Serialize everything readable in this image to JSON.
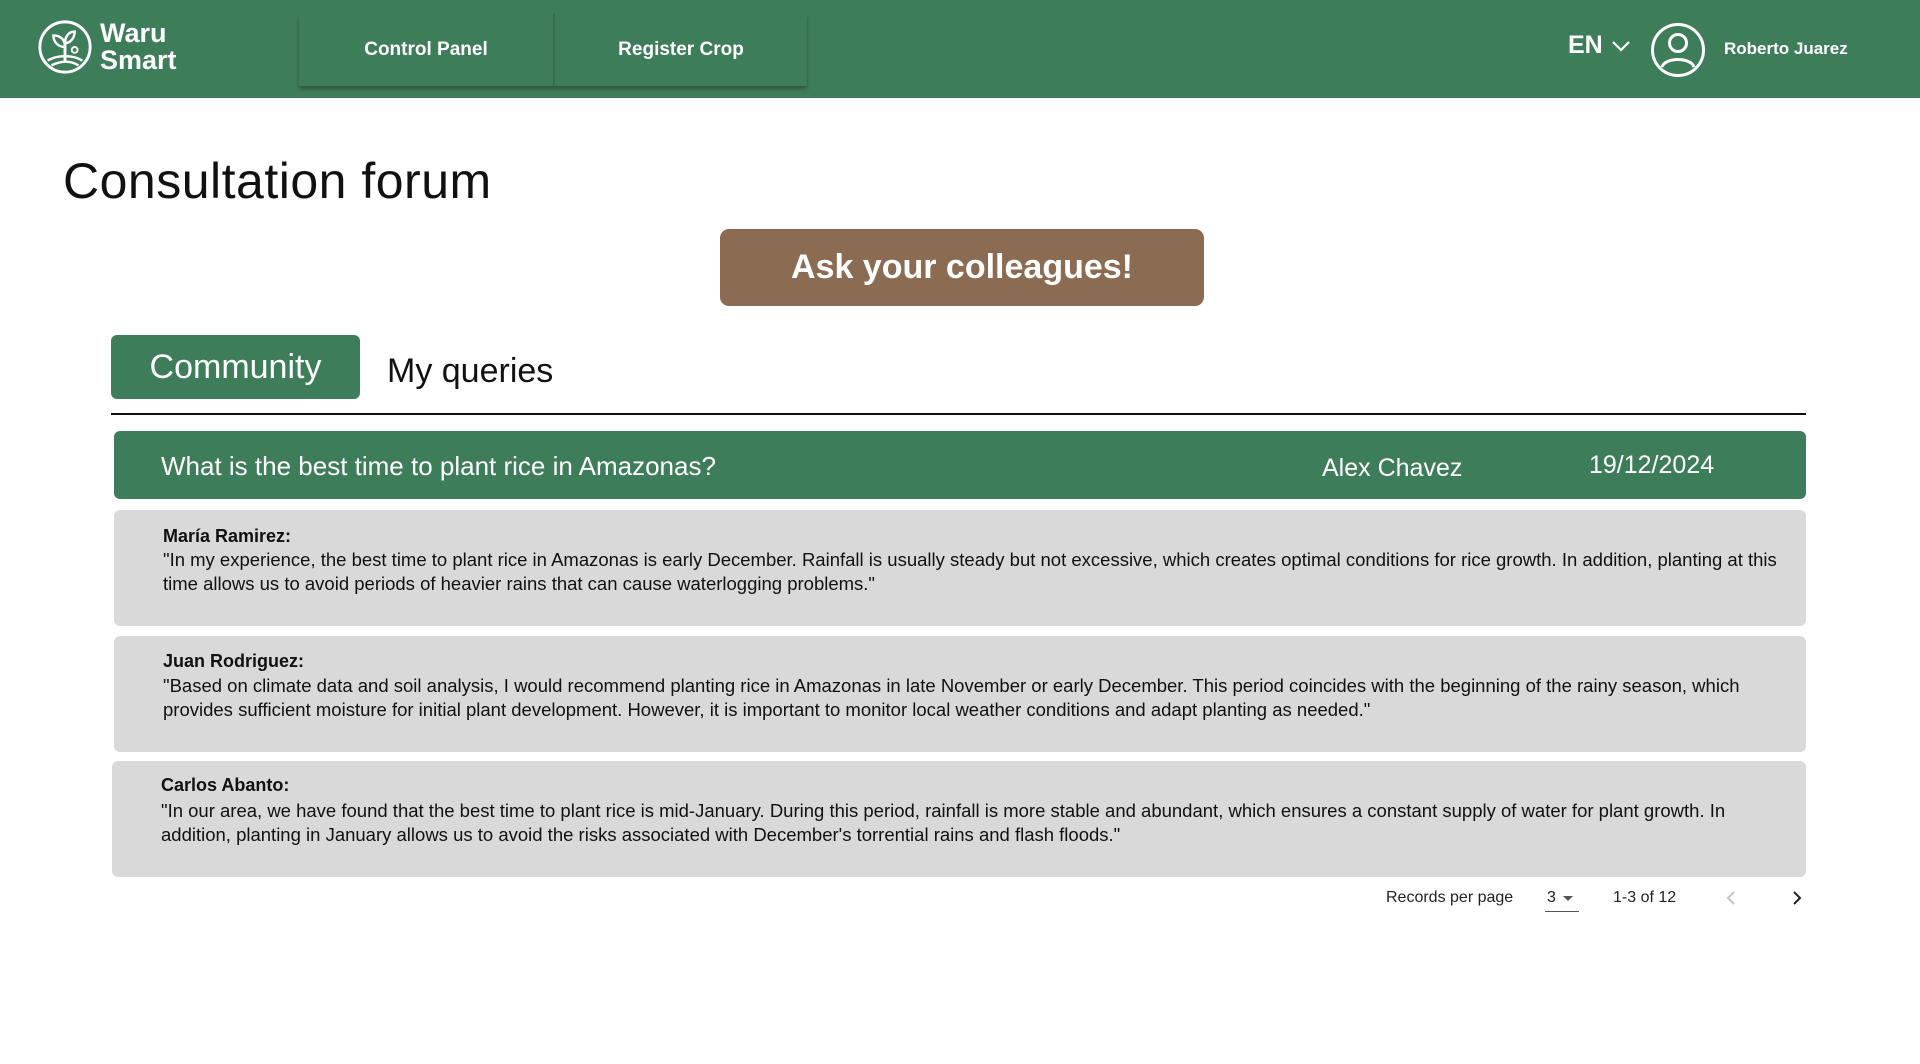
{
  "header": {
    "logo_line1": "Waru",
    "logo_line2": "Smart",
    "nav": [
      {
        "label": "Control Panel"
      },
      {
        "label": "Register Crop"
      }
    ],
    "language": "EN",
    "username": "Roberto Juarez"
  },
  "main": {
    "title": "Consultation forum",
    "ask_button": "Ask your colleagues!",
    "tabs": [
      {
        "label": "Community",
        "active": true
      },
      {
        "label": "My queries",
        "active": false
      }
    ],
    "question": {
      "text": "What is the best time to plant rice in Amazonas?",
      "author": "Alex Chavez",
      "date": "19/12/2024"
    },
    "answers": [
      {
        "author": "María Ramirez:",
        "text": " \"In my experience, the best time to plant rice in Amazonas is early December. Rainfall is usually steady but not excessive, which creates optimal conditions for rice growth. In addition, planting at this time allows us to avoid periods of heavier rains that can cause waterlogging problems.\""
      },
      {
        "author": "Juan Rodriguez:",
        "text": "\"Based on climate data and soil analysis, I would recommend planting rice in Amazonas in late November or early December. This period coincides with the beginning of the rainy season, which provides sufficient moisture for initial plant development. However, it is important to monitor local weather conditions and adapt planting as needed.\""
      },
      {
        "author": "Carlos Abanto:",
        "text": " \"In our area, we have found that the best time to plant rice is mid-January. During this period, rainfall is more stable and abundant, which ensures a constant supply of water for plant growth. In addition, planting in January allows us to avoid the risks associated with December's torrential rains and flash floods.\""
      }
    ],
    "pagination": {
      "label": "Records per page",
      "per_page": "3",
      "range": "1-3 of 12"
    }
  },
  "colors": {
    "brand_green": "#3e7d5a",
    "button_brown": "#8b6b51",
    "card_gray": "#d9d9d9"
  },
  "icons": [
    "waru-smart-logo-icon",
    "chevron-down-icon",
    "user-avatar-icon",
    "chevron-left-icon",
    "chevron-right-icon",
    "dropdown-caret-icon"
  ]
}
